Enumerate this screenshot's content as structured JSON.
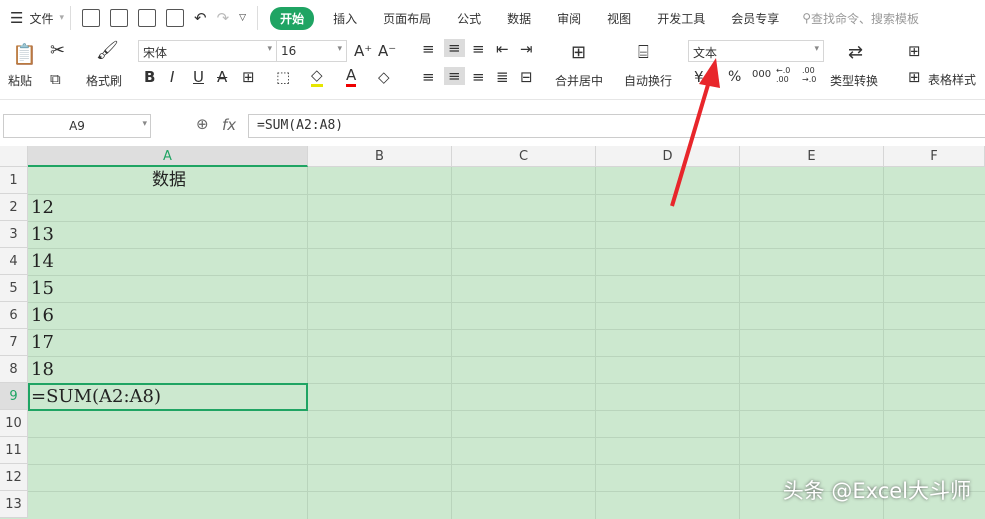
{
  "menu": {
    "file": "文件",
    "tabs": [
      "开始",
      "插入",
      "页面布局",
      "公式",
      "数据",
      "审阅",
      "视图",
      "开发工具",
      "会员专享"
    ],
    "search_placeholder": "查找命令、搜索模板"
  },
  "ribbon": {
    "paste": "粘贴",
    "format_painter": "格式刷",
    "font_name": "宋体",
    "font_size": "16",
    "merge_center": "合并居中",
    "wrap_text": "自动换行",
    "number_format": "文本",
    "type_convert": "类型转换",
    "table_style": "表格样式",
    "percent": "%",
    "thousands": "000",
    "inc_decimal": "←.0 .00",
    "dec_decimal": ".00 →.0"
  },
  "formula_bar": {
    "name_box": "A9",
    "fx": "fx",
    "formula": "=SUM(A2:A8)"
  },
  "columns": [
    "A",
    "B",
    "C",
    "D",
    "E",
    "F"
  ],
  "rows": [
    "1",
    "2",
    "3",
    "4",
    "5",
    "6",
    "7",
    "8",
    "9",
    "10",
    "11",
    "12",
    "13"
  ],
  "cells": [
    "数据",
    "12",
    "13",
    "14",
    "15",
    "16",
    "17",
    "18",
    "=SUM(A2:A8)"
  ],
  "watermark": "头条 @Excel大斗师",
  "colors": {
    "accent": "#1fa463",
    "cell_bg": "#cce8cf",
    "arrow": "#e8262b"
  }
}
